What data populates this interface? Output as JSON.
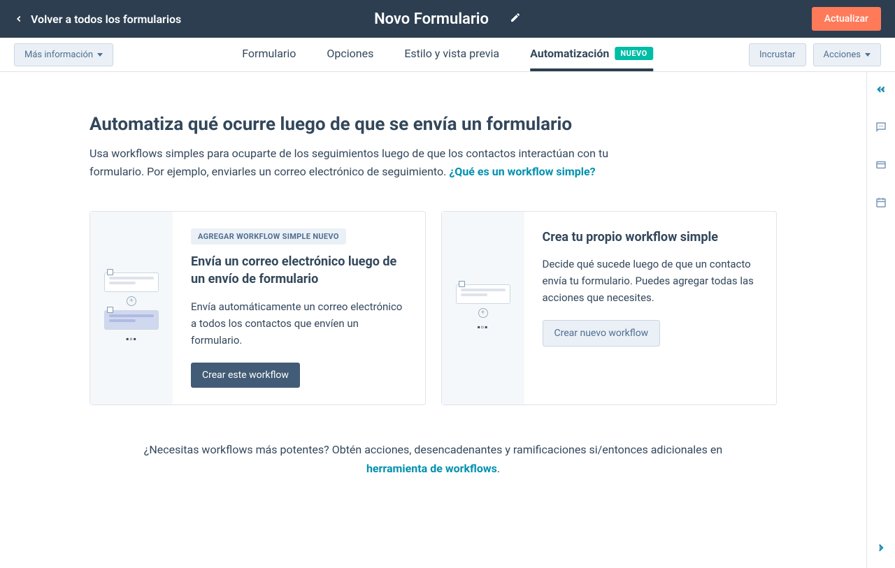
{
  "header": {
    "back_label": "Volver a todos los formularios",
    "title": "Novo Formulario",
    "update_label": "Actualizar"
  },
  "nav": {
    "more_info_label": "Más información",
    "tabs": {
      "formulario": "Formulario",
      "opciones": "Opciones",
      "estilo": "Estilo y vista previa",
      "automatizacion": "Automatización"
    },
    "badge_new": "NUEVO",
    "embed_label": "Incrustar",
    "actions_label": "Acciones"
  },
  "main": {
    "heading": "Automatiza qué ocurre luego de que se envía un formulario",
    "subtitle": "Usa workflows simples para ocuparte de los seguimientos luego de que los contactos interactúan con tu formulario. Por ejemplo, enviarles un correo electrónico de seguimiento. ",
    "what_is_link": " ¿Qué es un workflow simple?"
  },
  "card1": {
    "tag": "AGREGAR WORKFLOW SIMPLE NUEVO",
    "title": "Envía un correo electrónico luego de un envío de formulario",
    "desc": "Envía automáticamente un correo electrónico a todos los contactos que envíen un formulario.",
    "button": "Crear este workflow"
  },
  "card2": {
    "title": "Crea tu propio workflow simple",
    "desc": "Decide qué sucede luego de que un contacto envía tu formulario. Puedes agregar todas las acciones que necesites.",
    "button": "Crear nuevo workflow"
  },
  "footer": {
    "text_before": "¿Necesitas workflows más potentes? Obtén acciones, desencadenantes y ramificaciones si/entonces adicionales en ",
    "link": "herramienta de workflows",
    "text_after": "."
  }
}
